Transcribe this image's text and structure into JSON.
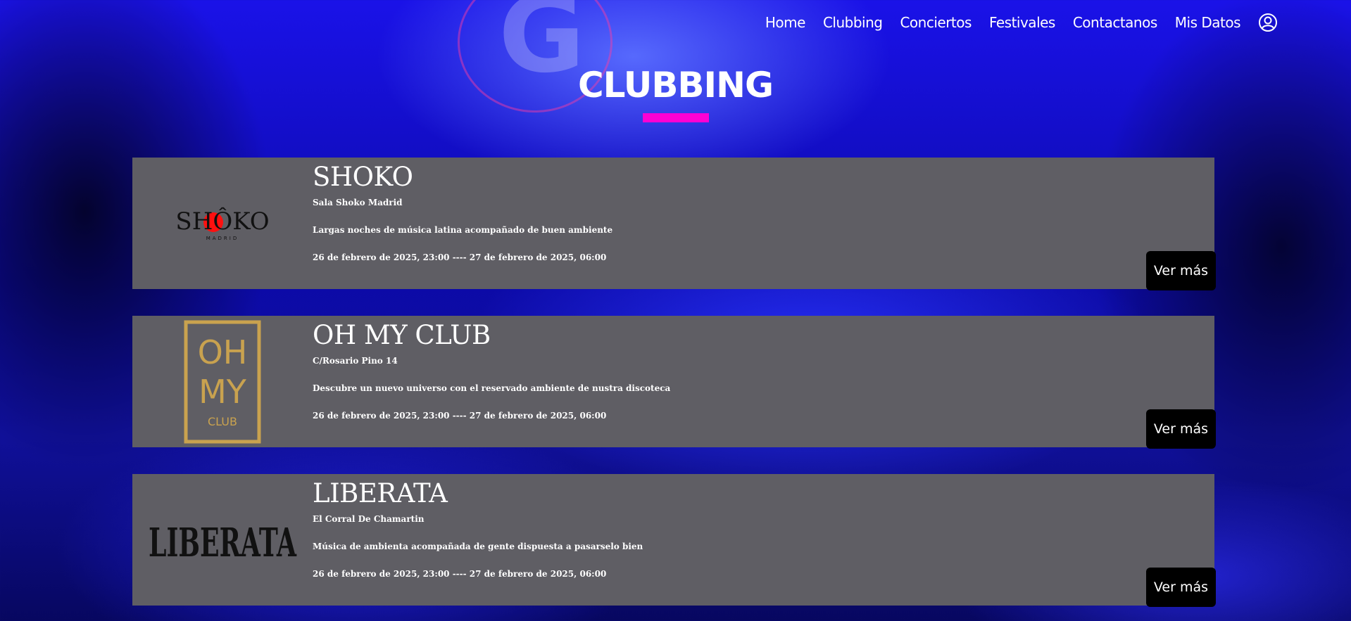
{
  "nav": {
    "items": [
      "Home",
      "Clubbing",
      "Conciertos",
      "Festivales",
      "Contactanos",
      "Mis Datos"
    ],
    "user_icon": "user-circle-icon"
  },
  "page": {
    "title": "CLUBBING",
    "accent_color": "#ff00d4"
  },
  "cards": [
    {
      "logo_text": "SHÔKO",
      "logo_sub": "MADRID",
      "name": "SHOKO",
      "address": "Sala Shoko Madrid",
      "description": "Largas noches de música latina acompañado de buen ambiente",
      "dates": "26 de febrero de 2025, 23:00 ---- 27 de febrero de 2025, 06:00",
      "button": "Ver más"
    },
    {
      "logo_text": "OH MY CLUB",
      "name": "OH MY CLUB",
      "address": "C/Rosario Pino 14",
      "description": "Descubre un nuevo universo con el reservado ambiente de nustra discoteca",
      "dates": "26 de febrero de 2025, 23:00 ---- 27 de febrero de 2025, 06:00",
      "button": "Ver más"
    },
    {
      "logo_text": "LIBERATA",
      "name": "LIBERATA",
      "address": "El Corral De Chamartin",
      "description": "Música de ambienta acompañada de gente dispuesta a pasarselo bien",
      "dates": "26 de febrero de 2025, 23:00 ---- 27 de febrero de 2025, 06:00",
      "button": "Ver más"
    }
  ]
}
